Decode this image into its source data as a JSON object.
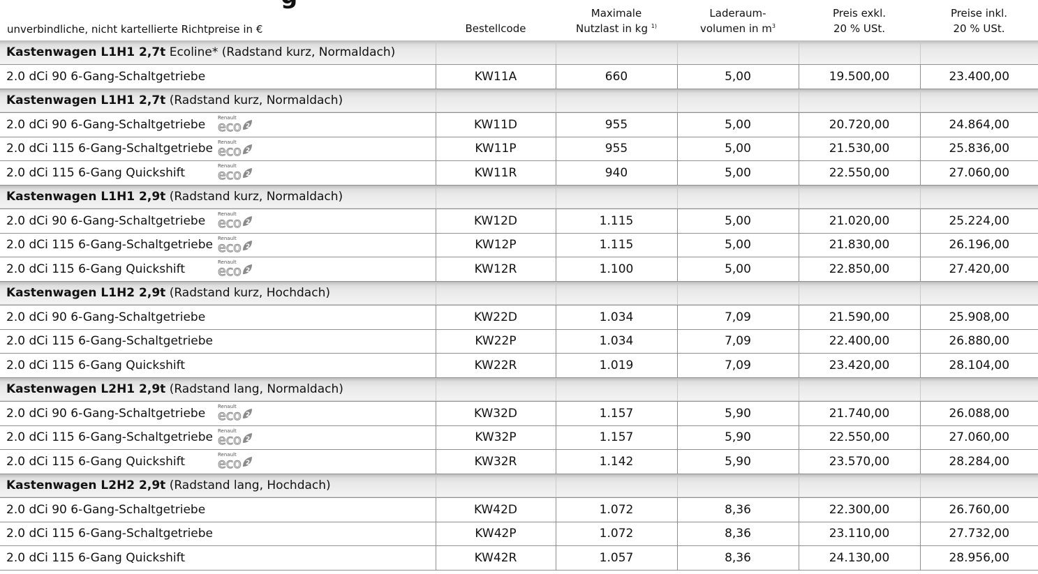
{
  "header": {
    "title_fragment": "g",
    "caption": "unverbindliche, nicht kartellierte Richtpreise in €",
    "columns": [
      {
        "line1": "",
        "line2": "Bestellcode",
        "sup": ""
      },
      {
        "line1": "Maximale",
        "line2": "Nutzlast in kg",
        "sup": "1)"
      },
      {
        "line1": "Laderaum-",
        "line2": "volumen in m",
        "sup": "3"
      },
      {
        "line1": "Preis exkl.",
        "line2": "20 % USt.",
        "sup": ""
      },
      {
        "line1": "Preise inkl.",
        "line2": "20 % USt.",
        "sup": ""
      }
    ]
  },
  "badge": {
    "brand": "Renault",
    "label": "eco2",
    "color": "#8a8a8a"
  },
  "groups": [
    {
      "title_bold": "Kastenwagen L1H1 2,7t",
      "title_rest": " Ecoline* (Radstand kurz, Normaldach)",
      "rows": [
        {
          "name": "2.0 dCi 90 6-Gang-Schaltgetriebe",
          "eco": false,
          "code": "KW11A",
          "payload": "660",
          "volume": "5,00",
          "price_excl": "19.500,00",
          "price_incl": "23.400,00"
        }
      ]
    },
    {
      "title_bold": "Kastenwagen L1H1 2,7t",
      "title_rest": " (Radstand kurz, Normaldach)",
      "rows": [
        {
          "name": "2.0 dCi 90 6-Gang-Schaltgetriebe",
          "eco": true,
          "code": "KW11D",
          "payload": "955",
          "volume": "5,00",
          "price_excl": "20.720,00",
          "price_incl": "24.864,00"
        },
        {
          "name": "2.0 dCi 115 6-Gang-Schaltgetriebe",
          "eco": true,
          "code": "KW11P",
          "payload": "955",
          "volume": "5,00",
          "price_excl": "21.530,00",
          "price_incl": "25.836,00"
        },
        {
          "name": "2.0 dCi 115 6-Gang Quickshift",
          "eco": true,
          "code": "KW11R",
          "payload": "940",
          "volume": "5,00",
          "price_excl": "22.550,00",
          "price_incl": "27.060,00"
        }
      ]
    },
    {
      "title_bold": "Kastenwagen L1H1 2,9t",
      "title_rest": " (Radstand kurz, Normaldach)",
      "rows": [
        {
          "name": "2.0 dCi 90 6-Gang-Schaltgetriebe",
          "eco": true,
          "code": "KW12D",
          "payload": "1.115",
          "volume": "5,00",
          "price_excl": "21.020,00",
          "price_incl": "25.224,00"
        },
        {
          "name": "2.0 dCi 115 6-Gang-Schaltgetriebe",
          "eco": true,
          "code": "KW12P",
          "payload": "1.115",
          "volume": "5,00",
          "price_excl": "21.830,00",
          "price_incl": "26.196,00"
        },
        {
          "name": "2.0 dCi 115 6-Gang Quickshift",
          "eco": true,
          "code": "KW12R",
          "payload": "1.100",
          "volume": "5,00",
          "price_excl": "22.850,00",
          "price_incl": "27.420,00"
        }
      ]
    },
    {
      "title_bold": "Kastenwagen L1H2 2,9t",
      "title_rest": " (Radstand kurz, Hochdach)",
      "rows": [
        {
          "name": "2.0 dCi 90 6-Gang-Schaltgetriebe",
          "eco": false,
          "code": "KW22D",
          "payload": "1.034",
          "volume": "7,09",
          "price_excl": "21.590,00",
          "price_incl": "25.908,00"
        },
        {
          "name": "2.0 dCi 115 6-Gang-Schaltgetriebe",
          "eco": false,
          "code": "KW22P",
          "payload": "1.034",
          "volume": "7,09",
          "price_excl": "22.400,00",
          "price_incl": "26.880,00"
        },
        {
          "name": "2.0 dCi 115 6-Gang Quickshift",
          "eco": false,
          "code": "KW22R",
          "payload": "1.019",
          "volume": "7,09",
          "price_excl": "23.420,00",
          "price_incl": "28.104,00"
        }
      ]
    },
    {
      "title_bold": "Kastenwagen L2H1 2,9t",
      "title_rest": " (Radstand lang, Normaldach)",
      "rows": [
        {
          "name": "2.0 dCi 90 6-Gang-Schaltgetriebe",
          "eco": true,
          "code": "KW32D",
          "payload": "1.157",
          "volume": "5,90",
          "price_excl": "21.740,00",
          "price_incl": "26.088,00"
        },
        {
          "name": "2.0 dCi 115 6-Gang-Schaltgetriebe",
          "eco": true,
          "code": "KW32P",
          "payload": "1.157",
          "volume": "5,90",
          "price_excl": "22.550,00",
          "price_incl": "27.060,00"
        },
        {
          "name": "2.0 dCi 115 6-Gang Quickshift",
          "eco": true,
          "code": "KW32R",
          "payload": "1.142",
          "volume": "5,90",
          "price_excl": "23.570,00",
          "price_incl": "28.284,00"
        }
      ]
    },
    {
      "title_bold": "Kastenwagen L2H2 2,9t",
      "title_rest": " (Radstand lang, Hochdach)",
      "rows": [
        {
          "name": "2.0 dCi 90 6-Gang-Schaltgetriebe",
          "eco": false,
          "code": "KW42D",
          "payload": "1.072",
          "volume": "8,36",
          "price_excl": "22.300,00",
          "price_incl": "26.760,00"
        },
        {
          "name": "2.0 dCi 115 6-Gang-Schaltgetriebe",
          "eco": false,
          "code": "KW42P",
          "payload": "1.072",
          "volume": "8,36",
          "price_excl": "23.110,00",
          "price_incl": "27.732,00"
        },
        {
          "name": "2.0 dCi 115 6-Gang Quickshift",
          "eco": false,
          "code": "KW42R",
          "payload": "1.057",
          "volume": "8,36",
          "price_excl": "24.130,00",
          "price_incl": "28.956,00"
        }
      ]
    }
  ]
}
